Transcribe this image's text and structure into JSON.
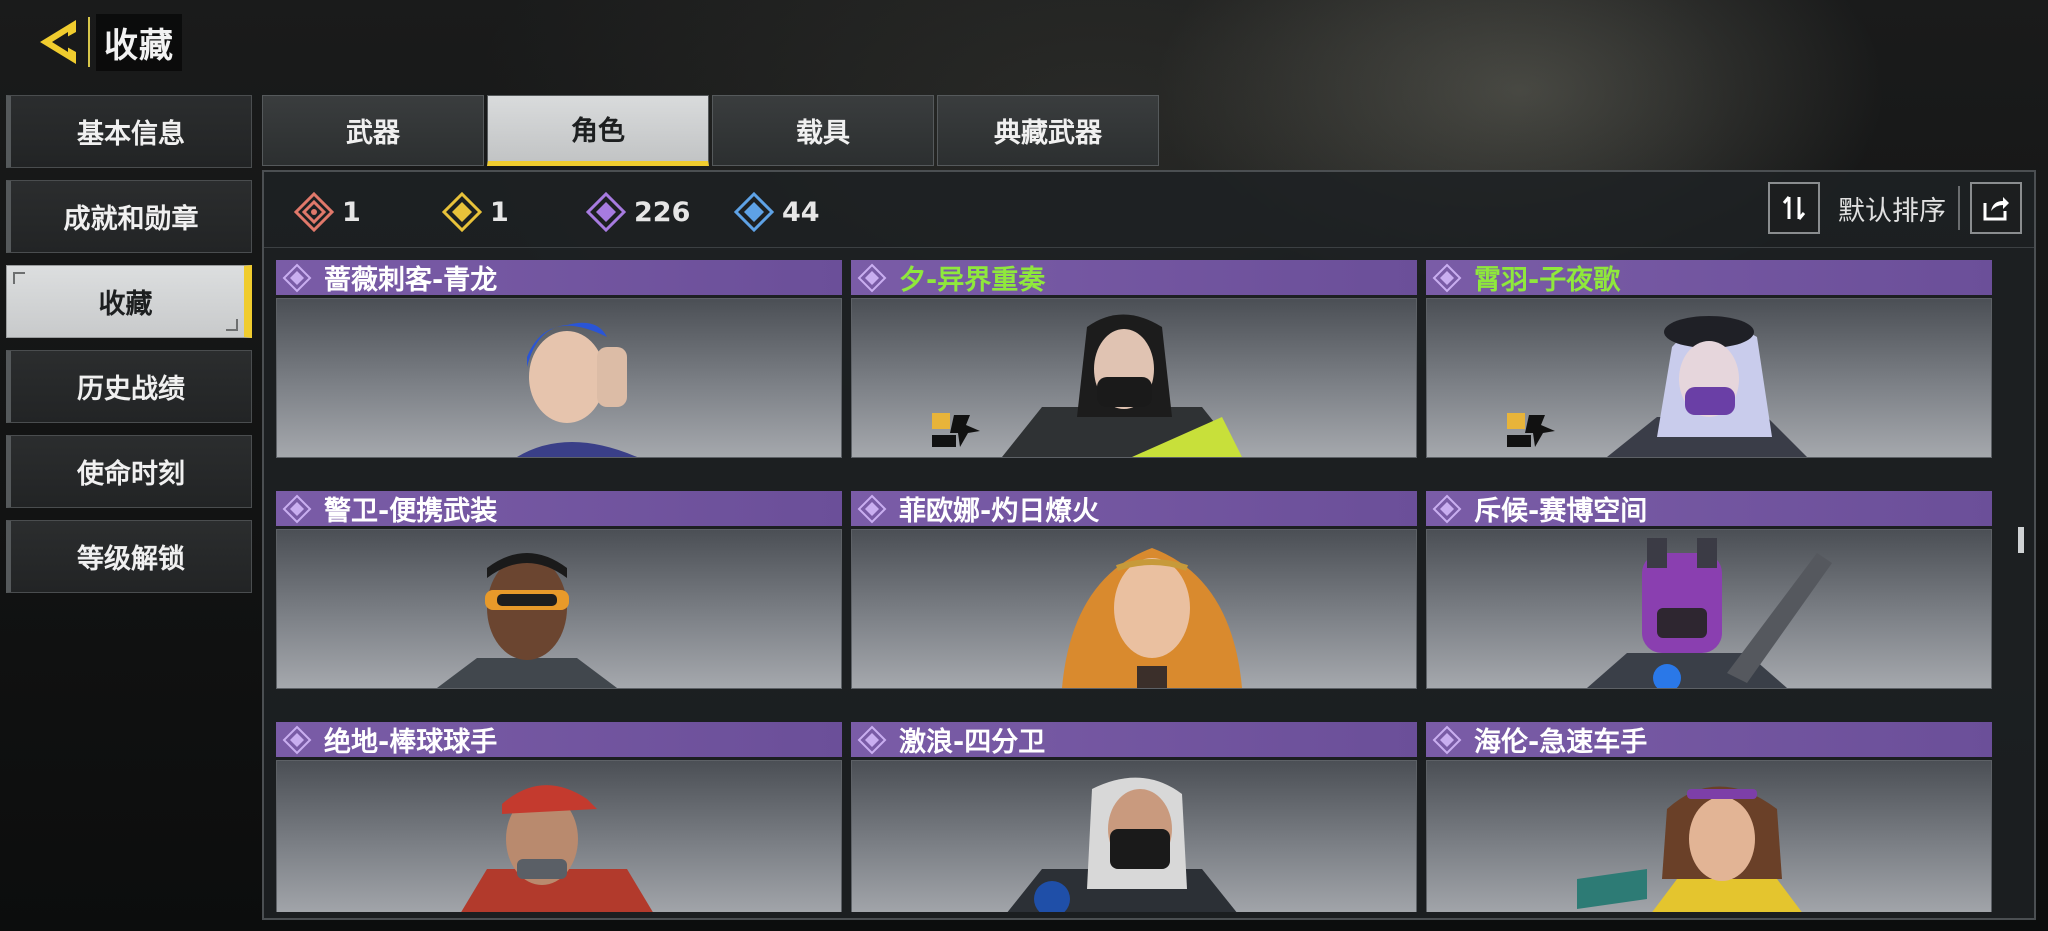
{
  "header": {
    "title": "收藏",
    "back_icon": "back-arrow-icon",
    "accent_color": "#f0cc2e"
  },
  "sidebar": {
    "items": [
      {
        "label": "基本信息",
        "active": false
      },
      {
        "label": "成就和勋章",
        "active": false
      },
      {
        "label": "收藏",
        "active": true
      },
      {
        "label": "历史战绩",
        "active": false
      },
      {
        "label": "使命时刻",
        "active": false
      },
      {
        "label": "等级解锁",
        "active": false
      }
    ]
  },
  "tabs": [
    {
      "label": "武器",
      "active": false
    },
    {
      "label": "角色",
      "active": true
    },
    {
      "label": "载具",
      "active": false
    },
    {
      "label": "典藏武器",
      "active": false
    }
  ],
  "summary": {
    "counters": [
      {
        "icon": "mythic-rarity-icon",
        "color": "#e0786a",
        "value": "1"
      },
      {
        "icon": "legendary-rarity-icon",
        "color": "#e8c23a",
        "value": "1"
      },
      {
        "icon": "epic-rarity-icon",
        "color": "#a77be0",
        "value": "226"
      },
      {
        "icon": "rare-rarity-icon",
        "color": "#5ea2e6",
        "value": "44"
      }
    ],
    "sort_label": "默认排序",
    "sort_icon": "sort-toggle-icon",
    "share_icon": "share-icon"
  },
  "cards": [
    {
      "name": "蔷薇刺客-青龙",
      "name_color": "#ffffff",
      "rarity_color": "#6b4f99",
      "collab_logo": false
    },
    {
      "name": "夕-异界重奏",
      "name_color": "#8fe83c",
      "rarity_color": "#6b4f99",
      "collab_logo": true
    },
    {
      "name": "霄羽-子夜歌",
      "name_color": "#8fe83c",
      "rarity_color": "#6b4f99",
      "collab_logo": true
    },
    {
      "name": "警卫-便携武装",
      "name_color": "#ffffff",
      "rarity_color": "#6b4f99",
      "collab_logo": false
    },
    {
      "name": "菲欧娜-灼日燎火",
      "name_color": "#ffffff",
      "rarity_color": "#6b4f99",
      "collab_logo": false
    },
    {
      "name": "斥候-赛博空间",
      "name_color": "#ffffff",
      "rarity_color": "#6b4f99",
      "collab_logo": false
    },
    {
      "name": "绝地-棒球球手",
      "name_color": "#ffffff",
      "rarity_color": "#6b4f99",
      "collab_logo": false
    },
    {
      "name": "激浪-四分卫",
      "name_color": "#ffffff",
      "rarity_color": "#6b4f99",
      "collab_logo": false
    },
    {
      "name": "海伦-急速车手",
      "name_color": "#ffffff",
      "rarity_color": "#6b4f99",
      "collab_logo": false
    }
  ]
}
